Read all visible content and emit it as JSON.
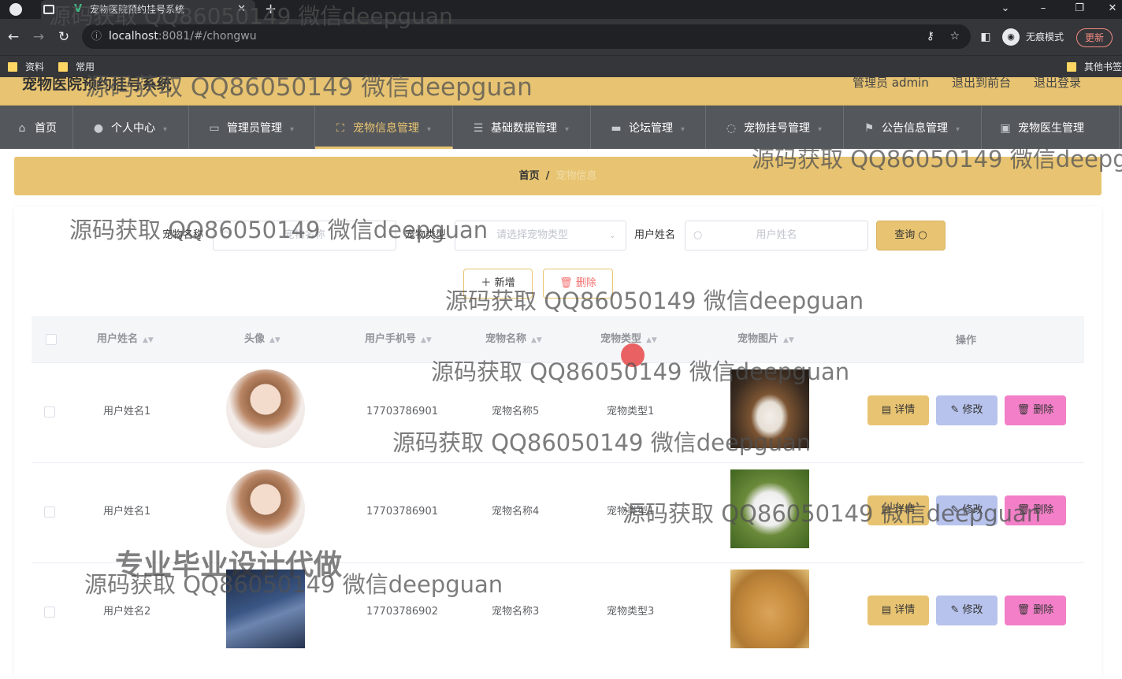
{
  "browser": {
    "tab_title": "宠物医院预约挂号系统",
    "new_tab": "+",
    "url_host": "localhost",
    "url_rest": ":8081/#/chongwu",
    "incognito_label": "无痕模式",
    "update_label": "更新",
    "bookmarks": [
      "资料",
      "常用"
    ],
    "other_bookmarks": "其他书签"
  },
  "app": {
    "title": "宠物医院预约挂号系统",
    "user_label": "管理员 admin",
    "to_front": "退出到前台",
    "logout": "退出登录"
  },
  "menu": [
    {
      "label": "首页",
      "icon": "home-icon"
    },
    {
      "label": "个人中心",
      "icon": "user-icon"
    },
    {
      "label": "管理员管理",
      "icon": "chat-icon"
    },
    {
      "label": "宠物信息管理",
      "icon": "frame-icon"
    },
    {
      "label": "基础数据管理",
      "icon": "list-icon"
    },
    {
      "label": "论坛管理",
      "icon": "monitor-icon"
    },
    {
      "label": "宠物挂号管理",
      "icon": "loading-icon"
    },
    {
      "label": "公告信息管理",
      "icon": "flag-icon"
    },
    {
      "label": "宠物医生管理",
      "icon": "clipboard-icon"
    }
  ],
  "breadcrumb": {
    "home": "首页",
    "sep": "/",
    "current": "宠物信息"
  },
  "search": {
    "pet_name_label": "宠物名称",
    "pet_name_placeholder": "宠物名称",
    "pet_type_label": "宠物类型",
    "pet_type_placeholder": "请选择宠物类型",
    "user_name_label": "用户姓名",
    "user_name_placeholder": "用户姓名",
    "query_label": "查询"
  },
  "actions": {
    "add_label": "新增",
    "delete_label": "删除"
  },
  "table": {
    "columns": [
      "用户姓名",
      "头像",
      "用户手机号",
      "宠物名称",
      "宠物类型",
      "宠物图片",
      "操作"
    ],
    "row_buttons": {
      "detail": "详情",
      "edit": "修改",
      "delete": "删除"
    },
    "rows": [
      {
        "user_name": "用户姓名1",
        "phone": "17703786901",
        "pet_name": "宠物名称5",
        "pet_type": "宠物类型1"
      },
      {
        "user_name": "用户姓名1",
        "phone": "17703786901",
        "pet_name": "宠物名称4",
        "pet_type": "宠物类型1"
      },
      {
        "user_name": "用户姓名2",
        "phone": "17703786902",
        "pet_name": "宠物名称3",
        "pet_type": "宠物类型3"
      }
    ]
  },
  "watermarks": {
    "text": "源码获取 QQ86050149 微信deepguan",
    "text_cut": "源码获取 QQ86050149 微信deepg",
    "big": "专业毕业设计代做"
  }
}
